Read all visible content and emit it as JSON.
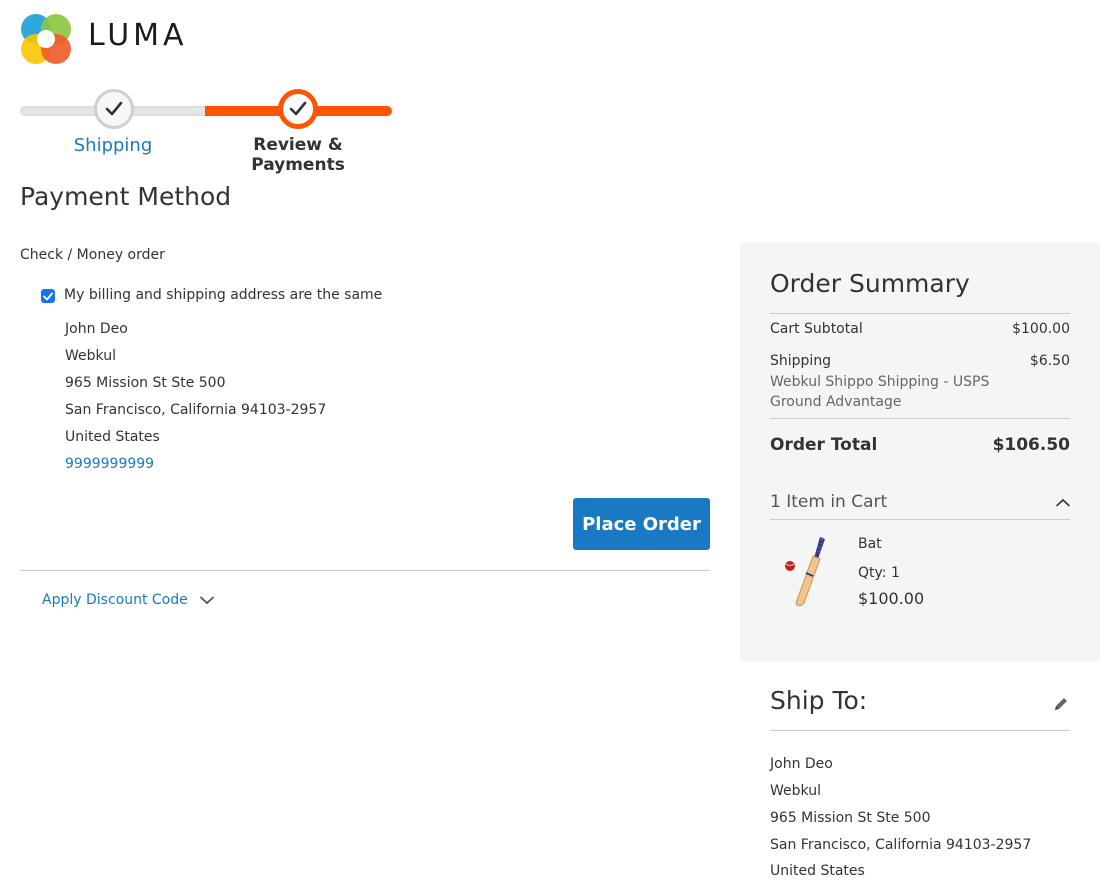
{
  "brand": {
    "name": "LUMA"
  },
  "progress": {
    "steps": [
      {
        "label": "Shipping",
        "state": "complete"
      },
      {
        "label": "Review & Payments",
        "state": "current"
      }
    ],
    "colors": {
      "active": "#ff5501",
      "inactive": "#e4e4e4",
      "link": "#1979c3"
    }
  },
  "payment": {
    "heading": "Payment Method",
    "method_title": "Check / Money order",
    "same_address_label": "My billing and shipping address are the same",
    "same_address_checked": true,
    "billing_address": {
      "name": "John Deo",
      "company": "Webkul",
      "street": "965 Mission St Ste 500",
      "city_line": "San Francisco, California 94103-2957",
      "country": "United States",
      "phone": "9999999999"
    },
    "place_order_label": "Place Order",
    "discount_label": "Apply Discount Code"
  },
  "summary": {
    "title": "Order Summary",
    "subtotal_label": "Cart Subtotal",
    "subtotal_value": "$100.00",
    "shipping_label": "Shipping",
    "shipping_value": "$6.50",
    "shipping_method": "Webkul Shippo Shipping - USPS Ground Advantage",
    "total_label": "Order Total",
    "total_value": "$106.50",
    "items_in_cart_label": "1 Item in Cart",
    "items": [
      {
        "name": "Bat",
        "qty_label": "Qty: 1",
        "price": "$100.00",
        "icon": "cricket-bat-icon"
      }
    ]
  },
  "ship_to": {
    "title": "Ship To:",
    "address": {
      "name": "John Deo",
      "company": "Webkul",
      "street": "965 Mission St Ste 500",
      "city_line": "San Francisco, California 94103-2957",
      "country": "United States"
    }
  }
}
